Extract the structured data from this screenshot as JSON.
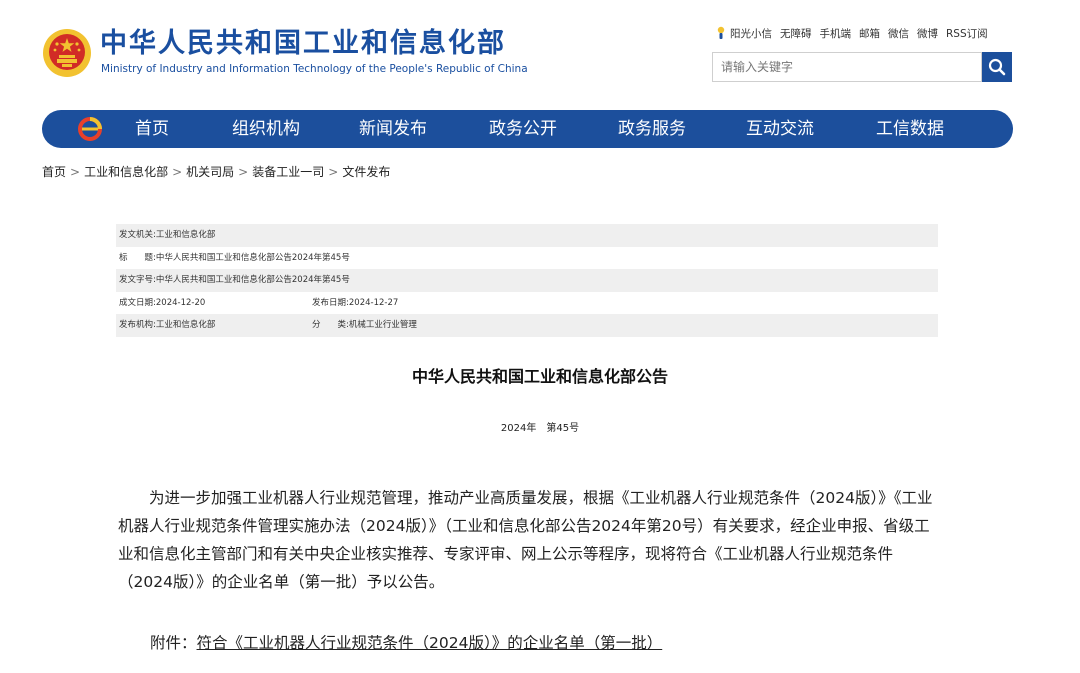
{
  "header": {
    "title": "中华人民共和国工业和信息化部",
    "subtitle": "Ministry of Industry and Information Technology of the People's Republic of China",
    "top_links": [
      "阳光小信",
      "无障碍",
      "手机端",
      "邮箱",
      "微信",
      "微博",
      "RSS订阅"
    ],
    "search_placeholder": "请输入关键字"
  },
  "colors": {
    "brand_blue": "#1c4f9c",
    "emblem_red": "#d12b26",
    "emblem_gold": "#f2c230"
  },
  "nav": {
    "items": [
      "首页",
      "组织机构",
      "新闻发布",
      "政务公开",
      "政务服务",
      "互动交流",
      "工信数据"
    ]
  },
  "breadcrumb": [
    "首页",
    "工业和信息化部",
    "机关司局",
    "装备工业一司",
    "文件发布"
  ],
  "meta": {
    "issuer_label": "发文机关:",
    "issuer": "工业和信息化部",
    "title_label": "标　　题:",
    "title": "中华人民共和国工业和信息化部公告2024年第45号",
    "docno_label": "发文字号:",
    "docno": "中华人民共和国工业和信息化部公告2024年第45号",
    "created_label": "成文日期:",
    "created": "2024-12-20",
    "published_label": "发布日期:",
    "published": "2024-12-27",
    "org_label": "发布机构:",
    "org": "工业和信息化部",
    "category_label": "分　　类:",
    "category": "机械工业行业管理"
  },
  "document": {
    "heading": "中华人民共和国工业和信息化部公告",
    "number": "2024年　第45号",
    "body": "为进一步加强工业机器人行业规范管理，推动产业高质量发展，根据《工业机器人行业规范条件（2024版）》《工业机器人行业规范条件管理实施办法（2024版）》（工业和信息化部公告2024年第20号）有关要求，经企业申报、省级工业和信息化主管部门和有关中央企业核实推荐、专家评审、网上公示等程序，现将符合《工业机器人行业规范条件（2024版）》的企业名单（第一批）予以公告。",
    "attachment_label": "附件：",
    "attachment_link": "符合《工业机器人行业规范条件（2024版）》的企业名单（第一批）"
  }
}
